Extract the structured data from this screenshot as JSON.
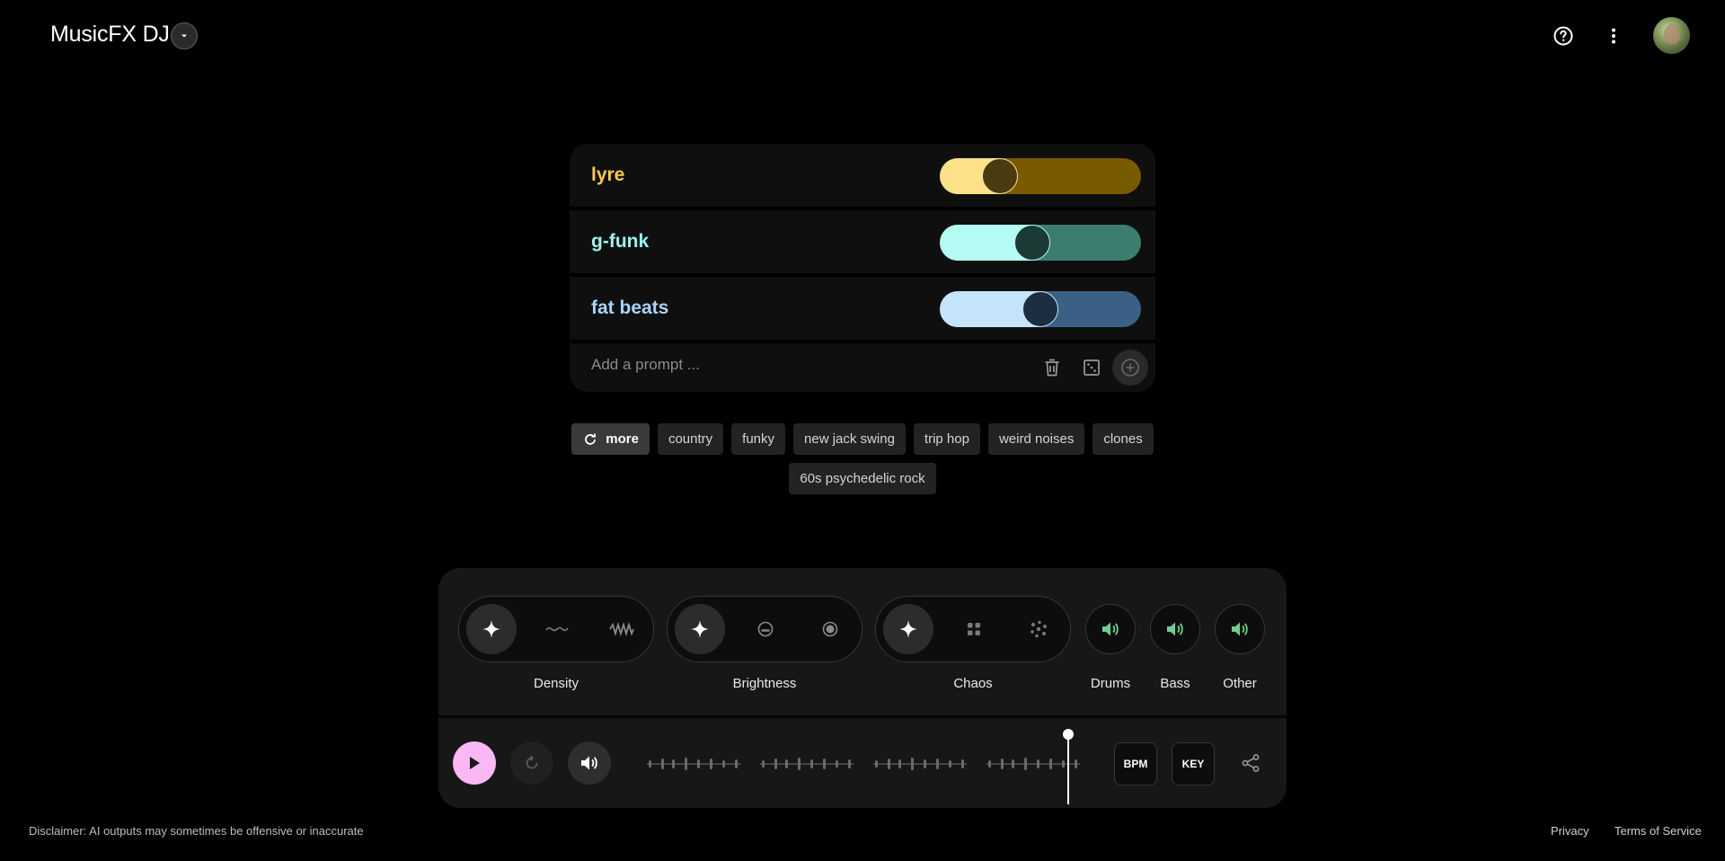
{
  "header": {
    "title": "MusicFX DJ",
    "dropdown_icon": "caret-down-icon",
    "help_icon": "help-circle-icon",
    "menu_icon": "more-vert-icon",
    "avatar_icon": "user-avatar"
  },
  "prompts": [
    {
      "label": "lyre",
      "weight": 0.3,
      "color": "#fbc94f",
      "track": "#7a5a00",
      "fill": "#fde28a",
      "knob": "#4a3a10"
    },
    {
      "label": "g-funk",
      "weight": 0.46,
      "color": "#9ef2ea",
      "track": "#3d7d70",
      "fill": "#b4fbf3",
      "knob": "#1c3a35"
    },
    {
      "label": "fat beats",
      "weight": 0.5,
      "color": "#a9d3f5",
      "track": "#3a6185",
      "fill": "#c4e4fb",
      "knob": "#1c2f42"
    }
  ],
  "add_prompt": {
    "placeholder": "Add a prompt ...",
    "delete_icon": "trash-icon",
    "random_icon": "dice-icon",
    "add_icon": "plus-circle-icon"
  },
  "chips": {
    "more_label": "more",
    "items": [
      "country",
      "funky",
      "new jack swing",
      "trip hop",
      "weird noises",
      "clones",
      "60s psychedelic rock"
    ]
  },
  "controls": {
    "density": {
      "label": "Density",
      "options": [
        "auto-sparkle-icon",
        "low-wave-icon",
        "high-wave-icon"
      ],
      "selected": 0
    },
    "brightness": {
      "label": "Brightness",
      "options": [
        "auto-sparkle-icon",
        "dim-icon",
        "bright-icon"
      ],
      "selected": 0
    },
    "chaos": {
      "label": "Chaos",
      "options": [
        "auto-sparkle-icon",
        "grid-dots-icon",
        "scatter-dots-icon"
      ],
      "selected": 0
    },
    "drums": {
      "label": "Drums",
      "icon": "volume-icon"
    },
    "bass": {
      "label": "Bass",
      "icon": "volume-icon"
    },
    "other": {
      "label": "Other",
      "icon": "volume-icon"
    }
  },
  "transport": {
    "play_icon": "play-icon",
    "reset_icon": "reset-icon",
    "volume_icon": "volume-icon",
    "bpm_label": "BPM",
    "key_label": "KEY",
    "share_icon": "share-icon",
    "playhead_position": 0.98
  },
  "footer": {
    "disclaimer": "Disclaimer: AI outputs may sometimes be offensive or inaccurate",
    "privacy": "Privacy",
    "terms": "Terms of Service"
  },
  "colors": {
    "background": "#000000",
    "play_accent": "#f9b8f4",
    "mute_accent": "#6fcf8f"
  }
}
